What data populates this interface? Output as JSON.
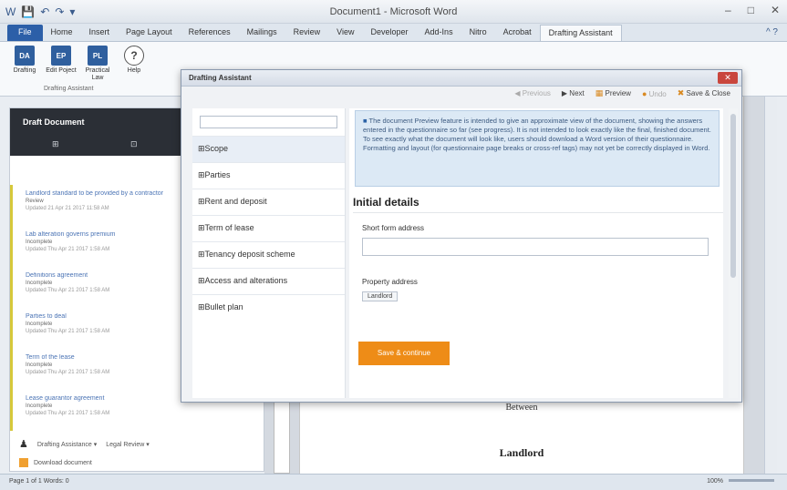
{
  "window": {
    "title": "Document1 - Microsoft Word",
    "controls": [
      "–",
      "□",
      "✕"
    ]
  },
  "quick_access": [
    "W",
    "💾",
    "↶",
    "↷",
    "▾"
  ],
  "ribbon_tabs": [
    "File",
    "Home",
    "Insert",
    "Page Layout",
    "References",
    "Mailings",
    "Review",
    "View",
    "Developer",
    "Add-Ins",
    "Nitro",
    "Acrobat",
    "Drafting Assistant"
  ],
  "ribbon_help": "^ ?",
  "ribbon_buttons": [
    {
      "icon": "DA",
      "label": "Drafting"
    },
    {
      "icon": "EP",
      "label": "Edit Poject"
    },
    {
      "icon": "PL",
      "label": "Practical Law"
    },
    {
      "icon": "?",
      "label": "Help"
    }
  ],
  "ribbon_group_label": "Drafting Assistant",
  "left_panel": {
    "title": "Draft Document",
    "icons": [
      "⊞",
      "⊡"
    ],
    "items": [
      {
        "title": "Landlord standard to be provided by a contractor",
        "status": "Review",
        "meta": "Updated 21 Apr 21 2017 11:58 AM"
      },
      {
        "title": "Lab alteration governs premium",
        "status": "Incomplete",
        "meta": "Updated Thu Apr 21 2017 1:58 AM"
      },
      {
        "title": "Definitions agreement",
        "status": "Incomplete",
        "meta": "Updated Thu Apr 21 2017 1:58 AM"
      },
      {
        "title": "Parties to deal",
        "status": "Incomplete",
        "meta": "Updated Thu Apr 21 2017 1:58 AM"
      },
      {
        "title": "Term of the lease",
        "status": "Incomplete",
        "meta": "Updated Thu Apr 21 2017 1:58 AM"
      },
      {
        "title": "Lease guarantor agreement",
        "status": "Incomplete",
        "meta": "Updated Thu Apr 21 2017 1:58 AM"
      }
    ],
    "footer_user": "Drafting Assistance ▾",
    "footer_filter": "Legal Review ▾",
    "footer_download": "Download document"
  },
  "document": {
    "line1": "Between",
    "line2": "Landlord"
  },
  "status_bar": {
    "left": "Page 1 of 1   Words: 0",
    "right": "100%"
  },
  "dialog": {
    "title": "Drafting Assistant",
    "close": "✕",
    "toolbar": [
      "Previous",
      "Next",
      "Preview",
      "Undo",
      "Save & Close"
    ],
    "search_placeholder": "",
    "nav": [
      "Scope",
      "Parties",
      "Rent and deposit",
      "Term of lease",
      "Tenancy deposit scheme",
      "Access and alterations",
      "Bullet plan"
    ],
    "info_text": "The document Preview feature is intended to give an approximate view of the document, showing the answers entered in the questionnaire so far (see progress). It is not intended to look exactly like the final, finished document. To see exactly what the document will look like, users should download a Word version of their questionnaire. Formatting and layout (for questionnaire page breaks or cross-ref tags) may not yet be correctly displayed in Word.",
    "section_title": "Initial details",
    "field_label": "Short form address",
    "field_value": "",
    "property_label": "Property address",
    "property_chip": "Landlord",
    "save_button": "Save & continue"
  }
}
